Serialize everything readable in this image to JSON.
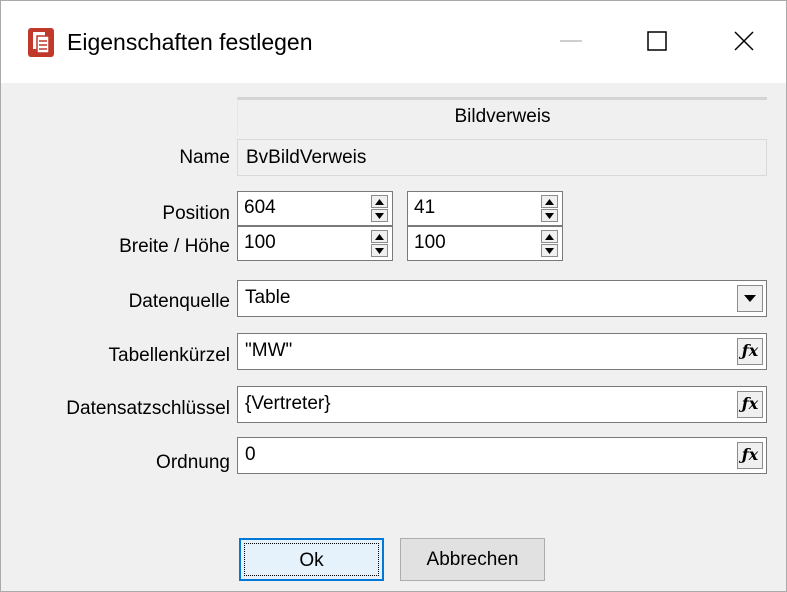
{
  "window": {
    "title": "Eigenschaften festlegen",
    "icons": {
      "app": "properties-app-icon",
      "minimize": "minimize-icon",
      "maximize": "maximize-icon",
      "close": "close-icon"
    }
  },
  "header": {
    "title": "Bildverweis"
  },
  "name": {
    "label": "Name",
    "value": "BvBildVerweis"
  },
  "position": {
    "label": "Position",
    "x": "604",
    "y": "41"
  },
  "size": {
    "label": "Breite / Höhe",
    "width": "100",
    "height": "100"
  },
  "datenquelle": {
    "label": "Datenquelle",
    "value": "Table"
  },
  "tabellenkuerzel": {
    "label": "Tabellenkürzel",
    "value": "\"MW\""
  },
  "datensatzschluessel": {
    "label": "Datensatzschlüssel",
    "value": "{Vertreter}"
  },
  "ordnung": {
    "label": "Ordnung",
    "value": "0"
  },
  "buttons": {
    "ok": "Ok",
    "cancel": "Abbrechen"
  }
}
